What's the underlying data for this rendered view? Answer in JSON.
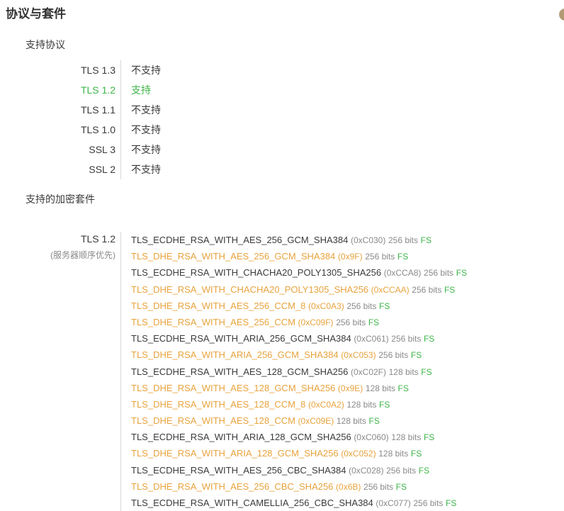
{
  "page": {
    "title": "协议与套件"
  },
  "colors": {
    "accent_rule": "#1e2f55",
    "supported_green": "#3db549",
    "weak_orange": "#e8a33d",
    "meta_gray": "#8a8a8a",
    "text_dark": "#3a3a3a"
  },
  "protocols": {
    "heading": "支持协议",
    "rows": [
      {
        "name": "TLS 1.3",
        "status": "不支持",
        "supported": false
      },
      {
        "name": "TLS 1.2",
        "status": "支持",
        "supported": true
      },
      {
        "name": "TLS 1.1",
        "status": "不支持",
        "supported": false
      },
      {
        "name": "TLS 1.0",
        "status": "不支持",
        "supported": false
      },
      {
        "name": "SSL 3",
        "status": "不支持",
        "supported": false
      },
      {
        "name": "SSL 2",
        "status": "不支持",
        "supported": false
      }
    ]
  },
  "cipher_suites": {
    "heading": "支持的加密套件",
    "group_label": "TLS 1.2",
    "group_note": "(服务器顺序优先)",
    "suites": [
      {
        "name": "TLS_ECDHE_RSA_WITH_AES_256_GCM_SHA384",
        "code": "(0xC030)",
        "bits": "256 bits",
        "fs": "FS",
        "weak": false
      },
      {
        "name": "TLS_DHE_RSA_WITH_AES_256_GCM_SHA384",
        "code": "(0x9F)",
        "bits": "256 bits",
        "fs": "FS",
        "weak": true
      },
      {
        "name": "TLS_ECDHE_RSA_WITH_CHACHA20_POLY1305_SHA256",
        "code": "(0xCCA8)",
        "bits": "256 bits",
        "fs": "FS",
        "weak": false
      },
      {
        "name": "TLS_DHE_RSA_WITH_CHACHA20_POLY1305_SHA256",
        "code": "(0xCCAA)",
        "bits": "256 bits",
        "fs": "FS",
        "weak": true
      },
      {
        "name": "TLS_DHE_RSA_WITH_AES_256_CCM_8",
        "code": "(0xC0A3)",
        "bits": "256 bits",
        "fs": "FS",
        "weak": true
      },
      {
        "name": "TLS_DHE_RSA_WITH_AES_256_CCM",
        "code": "(0xC09F)",
        "bits": "256 bits",
        "fs": "FS",
        "weak": true
      },
      {
        "name": "TLS_ECDHE_RSA_WITH_ARIA_256_GCM_SHA384",
        "code": "(0xC061)",
        "bits": "256 bits",
        "fs": "FS",
        "weak": false
      },
      {
        "name": "TLS_DHE_RSA_WITH_ARIA_256_GCM_SHA384",
        "code": "(0xC053)",
        "bits": "256 bits",
        "fs": "FS",
        "weak": true
      },
      {
        "name": "TLS_ECDHE_RSA_WITH_AES_128_GCM_SHA256",
        "code": "(0xC02F)",
        "bits": "128 bits",
        "fs": "FS",
        "weak": false
      },
      {
        "name": "TLS_DHE_RSA_WITH_AES_128_GCM_SHA256",
        "code": "(0x9E)",
        "bits": "128 bits",
        "fs": "FS",
        "weak": true
      },
      {
        "name": "TLS_DHE_RSA_WITH_AES_128_CCM_8",
        "code": "(0xC0A2)",
        "bits": "128 bits",
        "fs": "FS",
        "weak": true
      },
      {
        "name": "TLS_DHE_RSA_WITH_AES_128_CCM",
        "code": "(0xC09E)",
        "bits": "128 bits",
        "fs": "FS",
        "weak": true
      },
      {
        "name": "TLS_ECDHE_RSA_WITH_ARIA_128_GCM_SHA256",
        "code": "(0xC060)",
        "bits": "128 bits",
        "fs": "FS",
        "weak": false
      },
      {
        "name": "TLS_DHE_RSA_WITH_ARIA_128_GCM_SHA256",
        "code": "(0xC052)",
        "bits": "128 bits",
        "fs": "FS",
        "weak": true
      },
      {
        "name": "TLS_ECDHE_RSA_WITH_AES_256_CBC_SHA384",
        "code": "(0xC028)",
        "bits": "256 bits",
        "fs": "FS",
        "weak": false
      },
      {
        "name": "TLS_DHE_RSA_WITH_AES_256_CBC_SHA256",
        "code": "(0x6B)",
        "bits": "256 bits",
        "fs": "FS",
        "weak": true
      },
      {
        "name": "TLS_ECDHE_RSA_WITH_CAMELLIA_256_CBC_SHA384",
        "code": "(0xC077)",
        "bits": "256 bits",
        "fs": "FS",
        "weak": false
      }
    ]
  }
}
